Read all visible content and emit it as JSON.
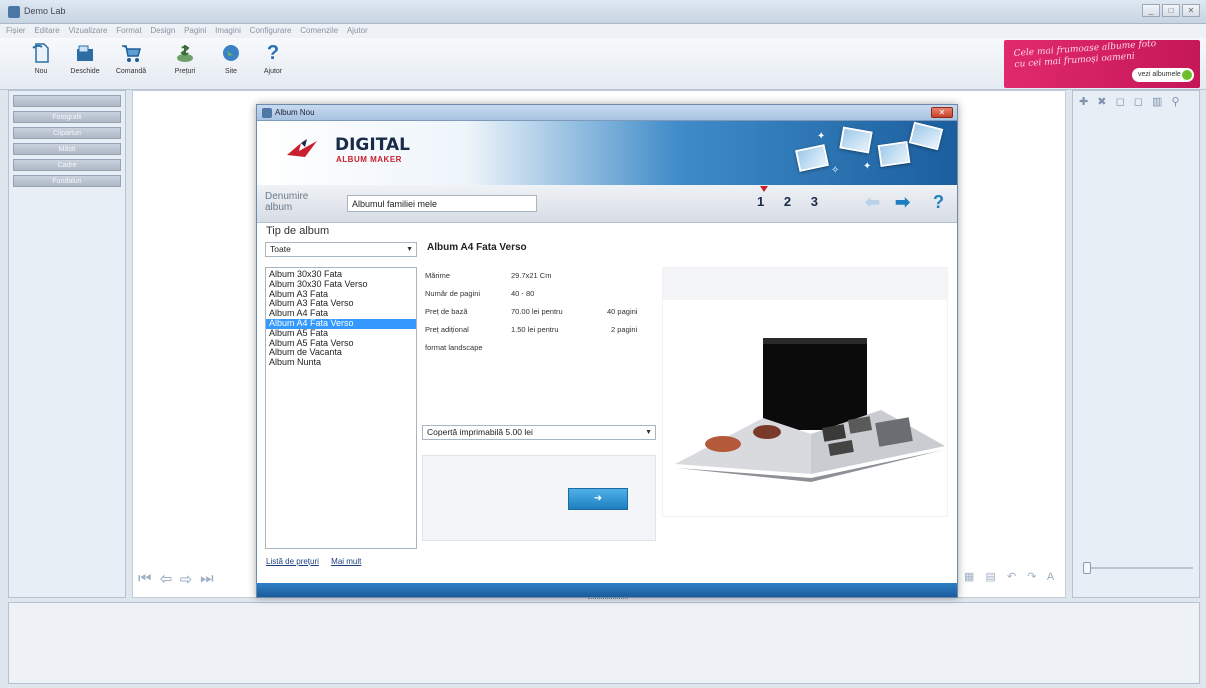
{
  "window": {
    "title": "Demo Lab",
    "controls": [
      "_",
      "□",
      "✕"
    ]
  },
  "menu": [
    "Fișier",
    "Editare",
    "Vizualizare",
    "Format",
    "Design",
    "Pagini",
    "Imagini",
    "Configurare",
    "Comenzile",
    "Ajutor"
  ],
  "toolbar": {
    "items": [
      {
        "label": "Nou",
        "icon": "new-doc-icon"
      },
      {
        "label": "Deschide",
        "icon": "open-folder-icon"
      },
      {
        "label": "Comandă",
        "icon": "cart-icon"
      },
      {
        "label": "Prețuri",
        "icon": "money-icon"
      },
      {
        "label": "Site",
        "icon": "globe-icon"
      },
      {
        "label": "Ajutor",
        "icon": "help-icon"
      }
    ]
  },
  "promo": {
    "text_line1": "Cele mai frumoase albume foto",
    "text_line2": "cu cei mai frumoși oameni",
    "button": "vezi albumele"
  },
  "left_panel": {
    "buttons": [
      "",
      "Fotografii",
      "Cliparturi",
      "Măști",
      "Cadre",
      "Fundaluri"
    ]
  },
  "dialog": {
    "title": "Album Nou",
    "close": "✕",
    "logo": {
      "title": "DIGITAL",
      "subtitle": "ALBUM MAKER"
    },
    "name_label": "Denumire album",
    "name_value": "Albumul familiei mele",
    "steps": [
      "1",
      "2",
      "3"
    ],
    "help": "?",
    "type_label": "Tip de album",
    "type_filter": "Toate",
    "albums": [
      "Album 30x30 Fata",
      "Album 30x30 Fata Verso",
      "Album A3 Fata",
      "Album A3 Fata Verso",
      "Album A4 Fata",
      "Album A4 Fata Verso",
      "Album A5 Fata",
      "Album A5 Fata Verso",
      "Album de Vacanta",
      "Album Nunta"
    ],
    "selected_album_index": 5,
    "detail": {
      "title": "Album A4 Fata Verso",
      "size_label": "Mărime",
      "size_value": "29.7x21 Cm",
      "pages_label": "Număr de pagini",
      "pages_value": "40 - 80",
      "base_price_label": "Preț de bază",
      "base_price_value": "70.00 lei pentru",
      "base_price_pages": "40 pagini",
      "extra_price_label": "Preț adițional",
      "extra_price_value": "1.50 lei pentru",
      "extra_price_pages": "2 pagini",
      "format": "format landscape"
    },
    "cover_select": "Copertă imprimabilă 5.00 lei",
    "next_button_icon": "next-step-icon",
    "links": [
      "Listă de prețuri",
      "Mai mult"
    ]
  },
  "colors": {
    "accent": "#3399ff",
    "promo": "#d9215f",
    "logo_red": "#c8202e"
  }
}
